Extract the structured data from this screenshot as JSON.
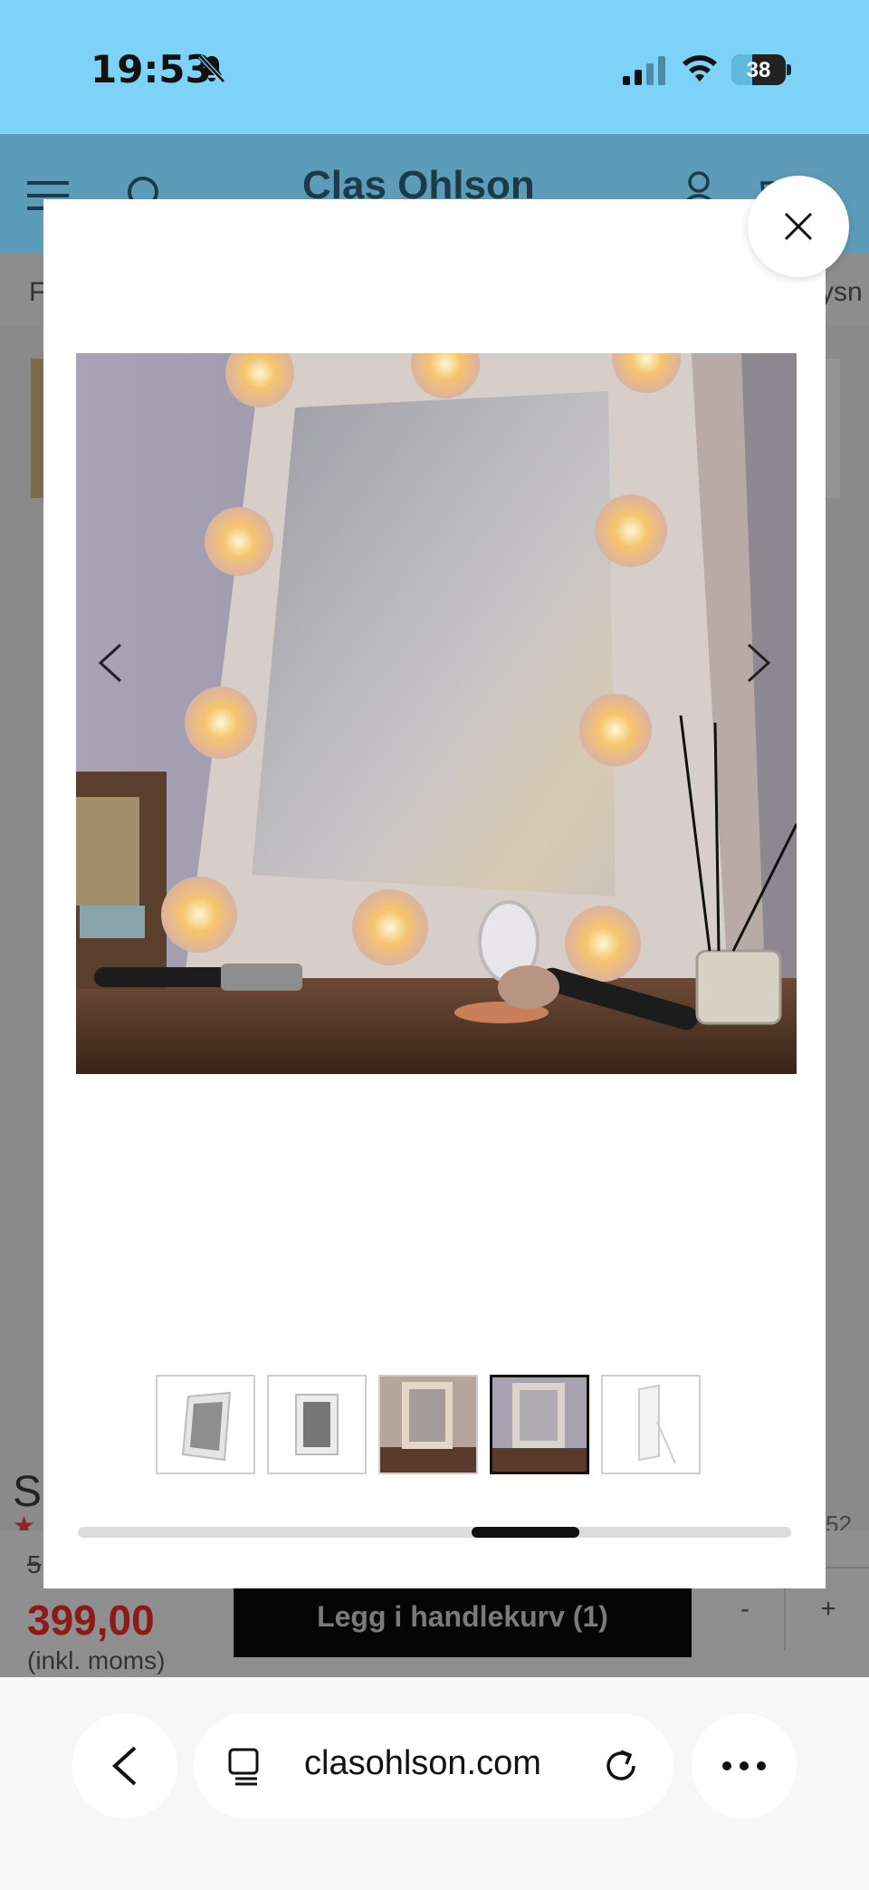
{
  "status_bar": {
    "time": "19:53",
    "battery": "38",
    "battery_level": 0.38,
    "icons": [
      "bell-slash-icon",
      "cellular-signal-icon",
      "wifi-icon",
      "battery-icon"
    ]
  },
  "site": {
    "logo": "Clas Ohlson",
    "nav_left": "F",
    "nav_right": "ysn",
    "product_title_partial": "Sp",
    "rating_star": "★",
    "review_count_partial": "52",
    "old_price_partial": "5",
    "price": "399,00",
    "vat_note": "(inkl. moms)",
    "add_to_cart": "Legg i handlekurv (1)",
    "qty_minus": "-",
    "qty_plus": "+"
  },
  "gallery": {
    "close_icon": "close-icon",
    "prev_icon": "chevron-left-icon",
    "next_icon": "chevron-right-icon",
    "thumbnail_count": 5,
    "active_thumbnail_index": 3,
    "scroll_position": 0.45,
    "scroll_visible_fraction": 0.15
  },
  "browser": {
    "url": "clasohlson.com",
    "back_icon": "chevron-left-icon",
    "tabs_icon": "tabs-icon",
    "reload_icon": "reload-icon",
    "more_icon": "more-icon"
  },
  "colors": {
    "status_bar": "#7dd3f7",
    "price": "#8c1a1a",
    "modal_bg": "#ffffff"
  }
}
